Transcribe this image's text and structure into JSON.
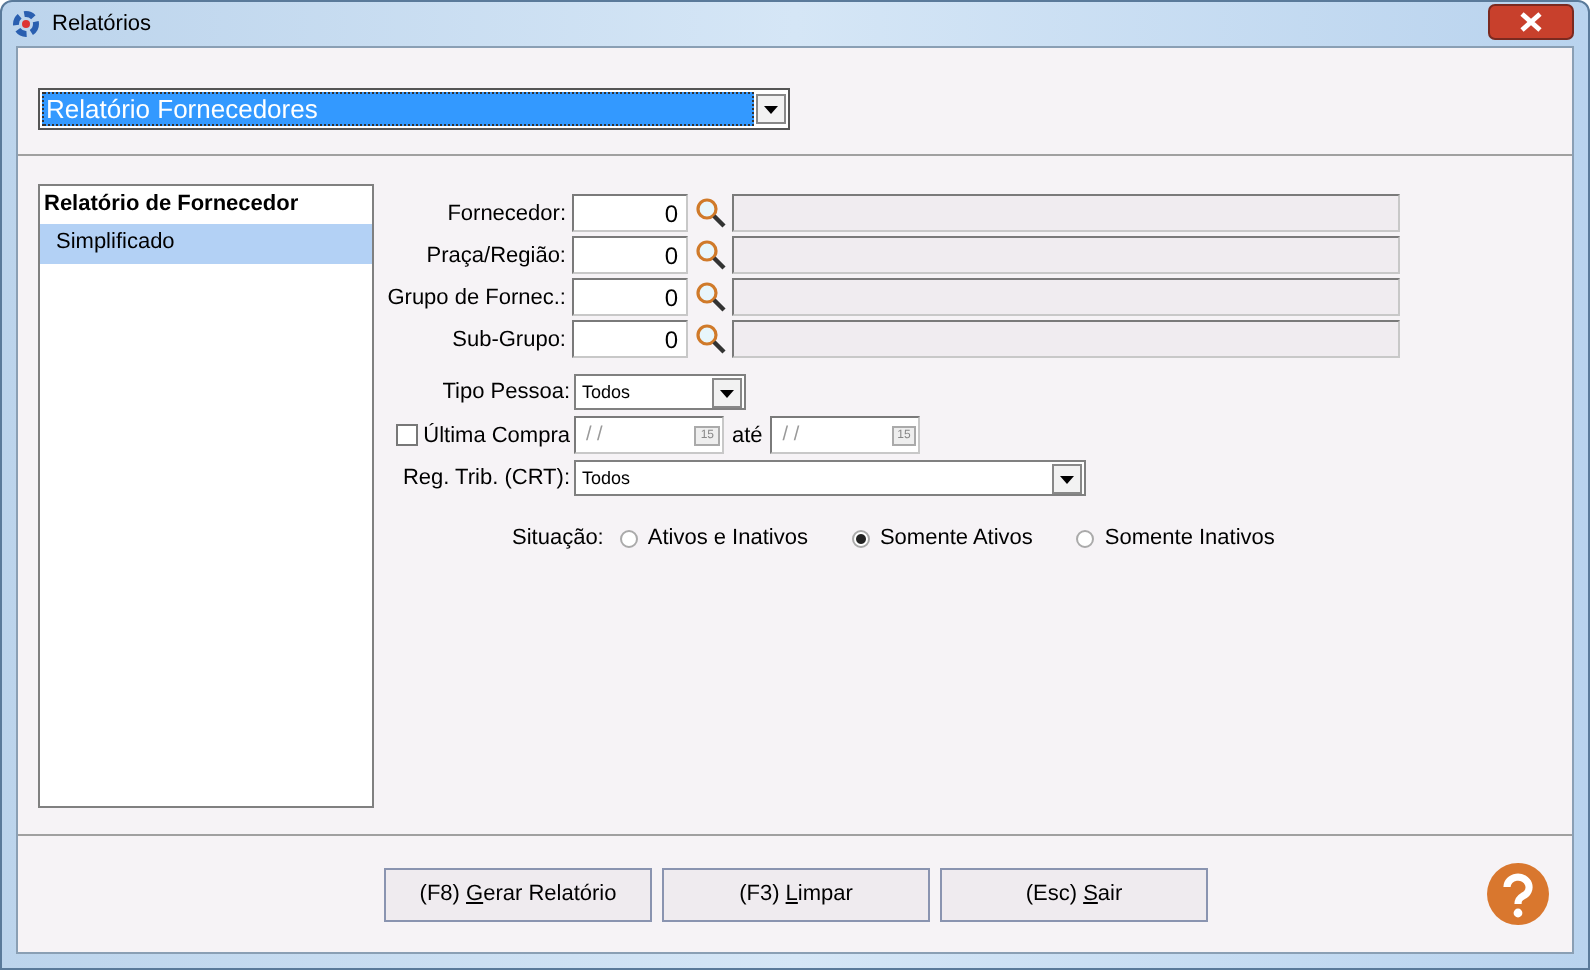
{
  "window": {
    "title": "Relatórios"
  },
  "report_selector": {
    "value": "Relatório Fornecedores"
  },
  "report_list": {
    "title": "Relatório de Fornecedor",
    "items": [
      {
        "label": "Simplificado",
        "selected": true
      }
    ]
  },
  "lookup_fields": [
    {
      "label": "Fornecedor:",
      "value": "0"
    },
    {
      "label": "Praça/Região:",
      "value": "0"
    },
    {
      "label": "Grupo de Fornec.:",
      "value": "0"
    },
    {
      "label": "Sub-Grupo:",
      "value": "0"
    }
  ],
  "tipo_pessoa": {
    "label": "Tipo Pessoa:",
    "value": "Todos"
  },
  "ultima_compra": {
    "label": "Última Compra",
    "checked": false,
    "date_from": "/ /",
    "date_to": "/ /",
    "calendar_day_from": "15",
    "calendar_day_to": "15",
    "separator": "até"
  },
  "reg_trib": {
    "label": "Reg. Trib. (CRT):",
    "value": "Todos"
  },
  "situacao": {
    "label": "Situação:",
    "options": [
      {
        "label": "Ativos e Inativos",
        "selected": false
      },
      {
        "label": "Somente Ativos",
        "selected": true
      },
      {
        "label": "Somente Inativos",
        "selected": false
      }
    ]
  },
  "buttons": [
    {
      "before": "(F8) ",
      "key": "G",
      "after": "erar Relatório"
    },
    {
      "before": "(F3) ",
      "key": "L",
      "after": "impar"
    },
    {
      "before": "(Esc) ",
      "key": "S",
      "after": "air"
    }
  ]
}
